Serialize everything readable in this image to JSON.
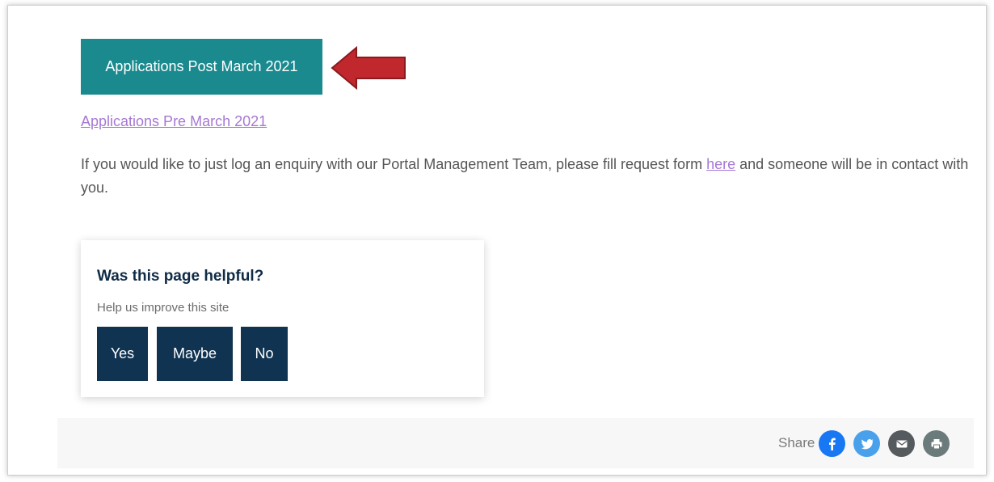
{
  "primary_button": {
    "label": "Applications Post March 2021"
  },
  "links": {
    "pre_march": "Applications Pre March 2021"
  },
  "body": {
    "text_before": "If you would like to just log an enquiry with our Portal Management Team, please fill request form ",
    "link": "here",
    "text_after": " and someone will be in contact with you."
  },
  "feedback": {
    "title": "Was this page helpful?",
    "subtitle": "Help us improve this site",
    "buttons": {
      "yes": "Yes",
      "maybe": "Maybe",
      "no": "No"
    }
  },
  "share": {
    "label": "Share",
    "icons": [
      {
        "name": "facebook-icon",
        "color": "#1877f2"
      },
      {
        "name": "twitter-icon",
        "color": "#4aa1eb"
      },
      {
        "name": "email-icon",
        "color": "#555a5f"
      },
      {
        "name": "print-icon",
        "color": "#6b7a7a"
      }
    ]
  },
  "colors": {
    "primary_button": "#1b8a8f",
    "link": "#a678d4",
    "feedback_button": "#0f3350",
    "annotation_arrow": "#c0282d"
  }
}
